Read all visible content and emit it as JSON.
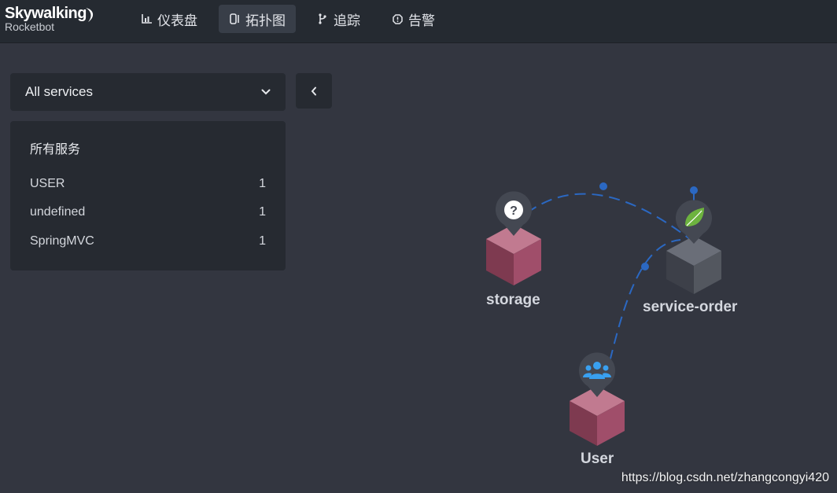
{
  "app": {
    "logo_title": "Skywalking",
    "logo_subtitle": "Rocketbot"
  },
  "nav": {
    "items": [
      {
        "label": "仪表盘",
        "icon": "bar-chart-icon",
        "active": false
      },
      {
        "label": "拓扑图",
        "icon": "topology-icon",
        "active": true
      },
      {
        "label": "追踪",
        "icon": "trace-icon",
        "active": false
      },
      {
        "label": "告警",
        "icon": "alarm-icon",
        "active": false
      }
    ]
  },
  "sidebar": {
    "select_value": "All services",
    "panel_title": "所有服务",
    "services": [
      {
        "name": "USER",
        "count": "1"
      },
      {
        "name": "undefined",
        "count": "1"
      },
      {
        "name": "SpringMVC",
        "count": "1"
      }
    ]
  },
  "topology": {
    "nodes": [
      {
        "label": "storage",
        "type": "unknown",
        "icon": "question-icon"
      },
      {
        "label": "service-order",
        "type": "SpringMVC",
        "icon": "spring-leaf-icon"
      },
      {
        "label": "User",
        "type": "USER",
        "icon": "users-icon"
      }
    ],
    "colors": {
      "node_pink": "#a04e6a",
      "node_gray": "#4f535d",
      "link": "#2b68c2"
    }
  },
  "watermark": "https://blog.csdn.net/zhangcongyi420"
}
